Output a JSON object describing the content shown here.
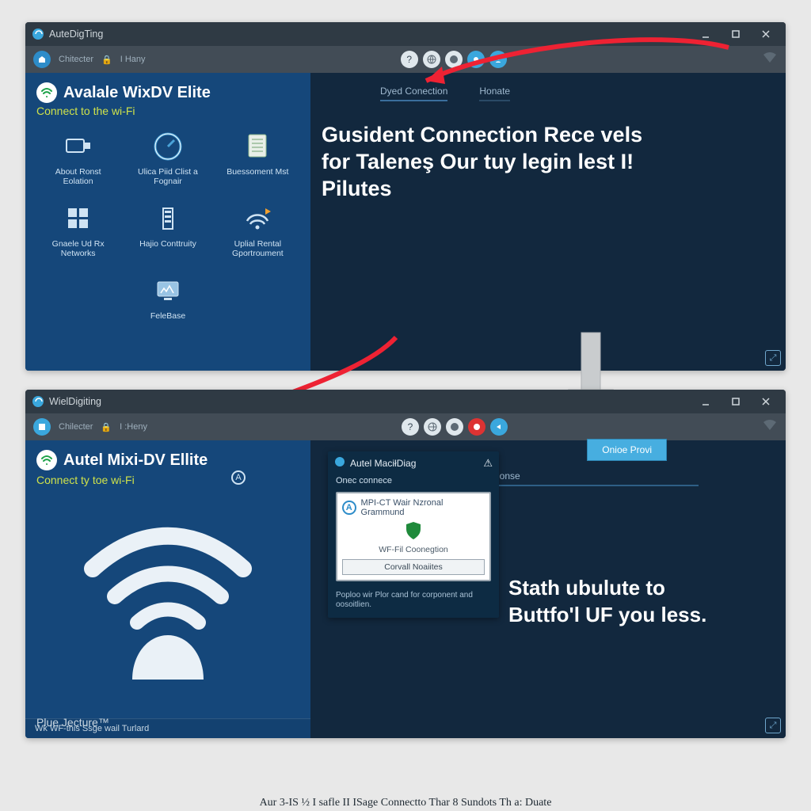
{
  "window1": {
    "title": "AuteDigTing",
    "toolbar_left": [
      "Chitecter",
      "I Hany"
    ],
    "tabs": [
      "Dyed Conection",
      "Honate"
    ],
    "brand": "Avalale WixDV Elite",
    "subline": "Connect to the wi-Fi",
    "big_text": "Gusident Connection Rece vels for Taleneş Our tuy legin lest I! Pilutes",
    "icons": [
      {
        "label": "About Ronst Eolation",
        "name": "about-icon"
      },
      {
        "label": "Ulica Piid Clist a Fognair",
        "name": "speed-icon"
      },
      {
        "label": "Buessoment Mst",
        "name": "list-icon"
      },
      {
        "label": "Gnaele Ud Rx Networks",
        "name": "windows-icon"
      },
      {
        "label": "Hajio Conttruity",
        "name": "tower-icon"
      },
      {
        "label": "Uplial Rental Gportroument",
        "name": "broadcast-icon"
      },
      {
        "label": "FeleBase",
        "name": "monitor-icon"
      }
    ]
  },
  "window2": {
    "title": "WielDigiting",
    "toolbar_left": [
      "Chilecter",
      "I :Heny"
    ],
    "brand": "Autel Mixi-DV Ellite",
    "subline": "Connect ty toe wi-Fi",
    "online_button": "Onioe Provi",
    "honse": "Honse",
    "big_text": "Stath ubulute to Buttfo'l UF you less.",
    "plujecture": "Plue Jecture™",
    "footer": "Wk WF-this Ssge wail Turlard",
    "a_label": "A",
    "popup": {
      "title": "Autel MaciłDiag",
      "sub": "Onec connece",
      "card_title": "MPI-CT Wair Nzronal Grammund",
      "card_sub": "WF-Fil Coonegtion",
      "card_btn": "Corvall Noaiites",
      "footer": "Poploo wir Plor cand for corponent and oosoitlien."
    }
  },
  "caption": "Aur 3-IS ½ I safle II ISage Connectto Thar 8 Sundots Th a: Duate"
}
